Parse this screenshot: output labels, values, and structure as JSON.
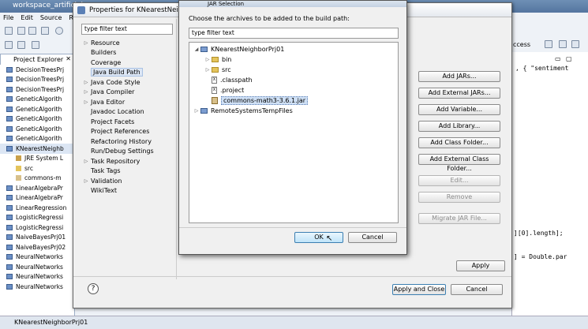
{
  "eclipse": {
    "title": "workspace_artificial",
    "menu": [
      "File",
      "Edit",
      "Source",
      "R"
    ],
    "explorer_tab": "Project Explorer",
    "tree": [
      {
        "label": "DecisionTreesPrj",
        "type": "project"
      },
      {
        "label": "DecisionTreesPrj",
        "type": "project"
      },
      {
        "label": "DecisionTreesPrj",
        "type": "project"
      },
      {
        "label": "GeneticAlgorith",
        "type": "project"
      },
      {
        "label": "GeneticAlgorith",
        "type": "project"
      },
      {
        "label": "GeneticAlgorith",
        "type": "project"
      },
      {
        "label": "GeneticAlgorith",
        "type": "project"
      },
      {
        "label": "GeneticAlgorith",
        "type": "project"
      },
      {
        "label": "KNearestNeighb",
        "type": "project"
      },
      {
        "label": "JRE System L",
        "type": "jre"
      },
      {
        "label": "src",
        "type": "folder"
      },
      {
        "label": "commons-m",
        "type": "jar"
      },
      {
        "label": "LinearAlgebraPr",
        "type": "project"
      },
      {
        "label": "LinearAlgebraPr",
        "type": "project"
      },
      {
        "label": "LinearRegression",
        "type": "project"
      },
      {
        "label": "LogisticRegressi",
        "type": "project"
      },
      {
        "label": "LogisticRegressi",
        "type": "project"
      },
      {
        "label": "NaiveBayesPrj01",
        "type": "project"
      },
      {
        "label": "NaiveBayesPrj02",
        "type": "project"
      },
      {
        "label": "NeuralNetworks",
        "type": "project"
      },
      {
        "label": "NeuralNetworks",
        "type": "project"
      },
      {
        "label": "NeuralNetworks",
        "type": "project"
      },
      {
        "label": "NeuralNetworks",
        "type": "project"
      }
    ],
    "status": "KNearestNeighborPrj01",
    "access_label": "ccess",
    "code_lines": [
      ", { \"sentiment",
      "][0].length];",
      "] = Double.par"
    ]
  },
  "properties": {
    "title": "Properties for KNearestNeighb",
    "filter_placeholder": "type filter text",
    "nav": [
      {
        "label": "Resource",
        "expandable": true
      },
      {
        "label": "Builders",
        "expandable": false
      },
      {
        "label": "Coverage",
        "expandable": false
      },
      {
        "label": "Java Build Path",
        "expandable": false,
        "selected": true
      },
      {
        "label": "Java Code Style",
        "expandable": true
      },
      {
        "label": "Java Compiler",
        "expandable": true
      },
      {
        "label": "Java Editor",
        "expandable": true
      },
      {
        "label": "Javadoc Location",
        "expandable": false
      },
      {
        "label": "Project Facets",
        "expandable": false
      },
      {
        "label": "Project References",
        "expandable": false
      },
      {
        "label": "Refactoring History",
        "expandable": false
      },
      {
        "label": "Run/Debug Settings",
        "expandable": false
      },
      {
        "label": "Task Repository",
        "expandable": true
      },
      {
        "label": "Task Tags",
        "expandable": false
      },
      {
        "label": "Validation",
        "expandable": true
      },
      {
        "label": "WikiText",
        "expandable": false
      }
    ],
    "buttons": {
      "add_jars": "Add JARs...",
      "add_external_jars": "Add External JARs...",
      "add_variable": "Add Variable...",
      "add_library": "Add Library...",
      "add_class_folder": "Add Class Folder...",
      "add_external_class_folder": "Add External Class Folder...",
      "edit": "Edit...",
      "remove": "Remove",
      "migrate_jar": "Migrate JAR File...",
      "apply": "Apply",
      "apply_and_close": "Apply and Close",
      "cancel": "Cancel"
    },
    "help": "?"
  },
  "jar_dialog": {
    "title": "JAR Selection",
    "instruction": "Choose the archives to be added to the build path:",
    "filter_value": "type filter text",
    "tree": {
      "project": "KNearestNeighborPrj01",
      "bin": "bin",
      "src": "src",
      "classpath": ".classpath",
      "project_file": ".project",
      "jar": "commons-math3-3.6.1.jar",
      "remote": "RemoteSystemsTempFiles"
    },
    "ok": "OK",
    "cancel": "Cancel"
  }
}
